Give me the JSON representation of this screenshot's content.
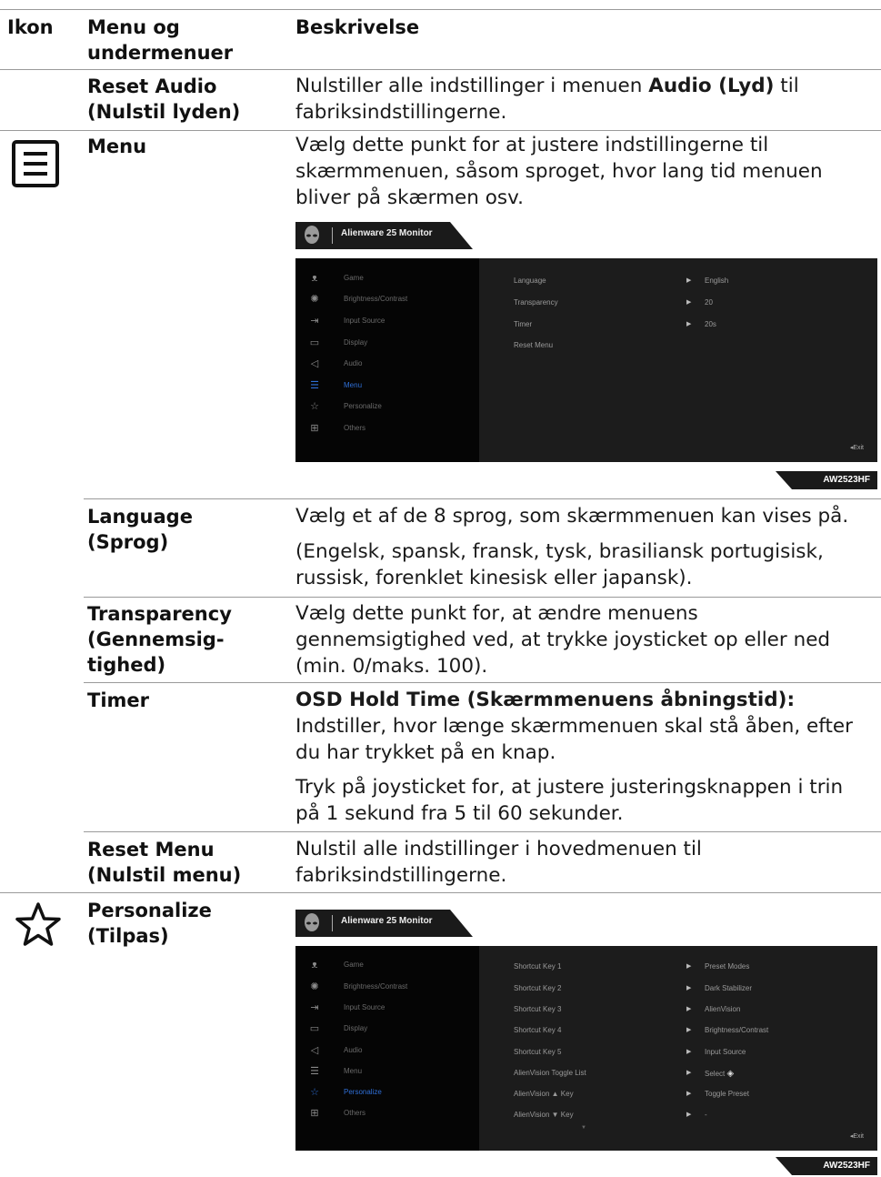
{
  "header": {
    "col_icon": "Ikon",
    "col_menu_line1": "Menu og",
    "col_menu_line2": "undermenuer",
    "col_desc": "Beskrivelse"
  },
  "rows": {
    "reset_audio": {
      "label_line1": "Reset Audio",
      "label_line2": "(Nulstil lyden)",
      "desc_pre": "Nulstiller alle indstillinger i menuen ",
      "desc_bold": "Audio (Lyd)",
      "desc_post": " til",
      "desc_line2": "fabriksindstillingerne."
    },
    "menu": {
      "label": "Menu",
      "desc_line1": "Vælg dette punkt for at justere indstillingerne til",
      "desc_line2": "skærmmenuen, såsom sproget, hvor lang tid menuen",
      "desc_line3": "bliver på skærmen osv."
    },
    "language": {
      "label_line1": "Language",
      "label_line2": "(Sprog)",
      "desc_line1": "Vælg et af de 8 sprog, som skærmmenuen kan vises på.",
      "desc_line2": "(Engelsk, spansk, fransk, tysk, brasiliansk portugisisk,",
      "desc_line3": "russisk, forenklet kinesisk eller japansk)."
    },
    "transparency": {
      "label_line1": "Transparency",
      "label_line2": "(Gennemsig-",
      "label_line3": "tighed)",
      "desc_line1": "Vælg dette punkt for, at ændre menuens",
      "desc_line2": "gennemsigtighed ved, at trykke joysticket op eller ned",
      "desc_line3": "(min. 0/maks. 100)."
    },
    "timer": {
      "label": "Timer",
      "desc_bold": "OSD Hold Time (Skærmmenuens åbningstid):",
      "desc_line2": "Indstiller, hvor længe skærmmenuen skal stå åben, efter",
      "desc_line3": "du har trykket på en knap.",
      "desc_line4": "Tryk på joysticket for, at justere justeringsknappen i trin",
      "desc_line5": "på 1 sekund fra 5 til 60 sekunder."
    },
    "reset_menu": {
      "label_line1": "Reset Menu",
      "label_line2": "(Nulstil menu)",
      "desc_line1": "Nulstil alle indstillinger i hovedmenuen til",
      "desc_line2": "fabriksindstillingerne."
    },
    "personalize": {
      "label_line1": "Personalize",
      "label_line2": "(Tilpas)"
    }
  },
  "osd": {
    "brand_title": "Alienware 25 Monitor",
    "model": "AW2523HF",
    "exit_label": "Exit",
    "menu_items": [
      "Game",
      "Brightness/Contrast",
      "Input Source",
      "Display",
      "Audio",
      "Menu",
      "Personalize",
      "Others"
    ],
    "menu_screen": {
      "active": "Menu",
      "rows": [
        {
          "key": "Language",
          "value": "English"
        },
        {
          "key": "Transparency",
          "value": "20"
        },
        {
          "key": "Timer",
          "value": "20s"
        },
        {
          "key": "Reset Menu",
          "value": ""
        }
      ]
    },
    "personalize_screen": {
      "active": "Personalize",
      "rows": [
        {
          "key": "Shortcut Key 1",
          "value": "Preset Modes"
        },
        {
          "key": "Shortcut Key 2",
          "value": "Dark Stabilizer"
        },
        {
          "key": "Shortcut Key 3",
          "value": "AlienVision"
        },
        {
          "key": "Shortcut Key 4",
          "value": "Brightness/Contrast"
        },
        {
          "key": "Shortcut Key 5",
          "value": "Input Source"
        },
        {
          "key": "AlienVision Toggle List",
          "value": "Select"
        },
        {
          "key": "AlienVision ▲ Key",
          "value": "Toggle Preset"
        },
        {
          "key": "AlienVision ▼ Key",
          "value": "-"
        }
      ]
    }
  }
}
